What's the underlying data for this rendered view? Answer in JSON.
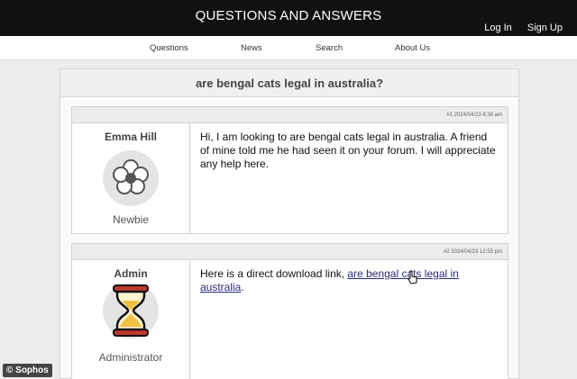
{
  "header": {
    "site_title": "QUESTIONS AND ANSWERS",
    "login_label": "Log In",
    "signup_label": "Sign Up"
  },
  "nav": {
    "items": [
      {
        "label": "Questions"
      },
      {
        "label": "News"
      },
      {
        "label": "Search"
      },
      {
        "label": "About Us"
      }
    ]
  },
  "question": {
    "title": "are bengal cats legal in australia?"
  },
  "posts": [
    {
      "meta": "#1 2024/04/23 8:39 am",
      "author": "Emma Hill",
      "role": "Newbie",
      "avatar_icon": "flower-icon",
      "body": "Hi, I am looking to are bengal cats legal in australia. A friend of mine told me he had seen it on your forum. I will appreciate any help here."
    },
    {
      "meta": "#2 2024/04/23 12:55 pm",
      "author": "Admin",
      "role": "Administrator",
      "avatar_icon": "hourglass-icon",
      "body_prefix": "Here is a direct download link, ",
      "link_text": "are bengal cats legal in australia",
      "body_suffix": "."
    }
  ],
  "watermark": "© Sophos",
  "colors": {
    "header_bg": "#111111",
    "link": "#2a2a7a",
    "hourglass_frame": "#c0392b",
    "hourglass_sand": "#f0c040"
  }
}
